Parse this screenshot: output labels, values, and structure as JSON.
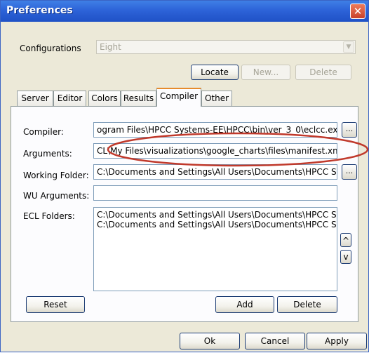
{
  "window": {
    "title": "Preferences",
    "close_symbol": "✕"
  },
  "config": {
    "label": "Configurations",
    "selected": "Eight",
    "locate_label": "Locate",
    "new_label": "New...",
    "delete_label": "Delete"
  },
  "tabs": [
    {
      "label": "Server"
    },
    {
      "label": "Editor"
    },
    {
      "label": "Colors"
    },
    {
      "label": "Results"
    },
    {
      "label": "Compiler"
    },
    {
      "label": "Other"
    }
  ],
  "compiler_tab": {
    "compiler_label": "Compiler:",
    "compiler_value": "ogram Files\\HPCC Systems-EE\\HPCC\\bin\\ver_3_0\\eclcc.exe",
    "arguments_label": "Arguments:",
    "arguments_value": "CL\\My Files\\visualizations\\google_charts\\files\\manifest.xml\"",
    "working_folder_label": "Working Folder:",
    "working_folder_value": "C:\\Documents and Settings\\All Users\\Documents\\HPCC Syst",
    "wu_arguments_label": "WU Arguments:",
    "wu_arguments_value": "",
    "ecl_folders_label": "ECL Folders:",
    "ecl_folders": [
      "C:\\Documents and Settings\\All Users\\Documents\\HPCC Syste",
      "C:\\Documents and Settings\\All Users\\Documents\\HPCC Syste"
    ],
    "browse_label": "...",
    "move_up_symbol": "^",
    "move_down_symbol": "v",
    "reset_label": "Reset",
    "add_label": "Add",
    "delete_label": "Delete"
  },
  "footer": {
    "ok_label": "Ok",
    "cancel_label": "Cancel",
    "apply_label": "Apply"
  },
  "colors": {
    "annotation_ring": "#c0392b",
    "title_bar": "#2d63d8",
    "active_tab_accent": "#e68b2c"
  }
}
